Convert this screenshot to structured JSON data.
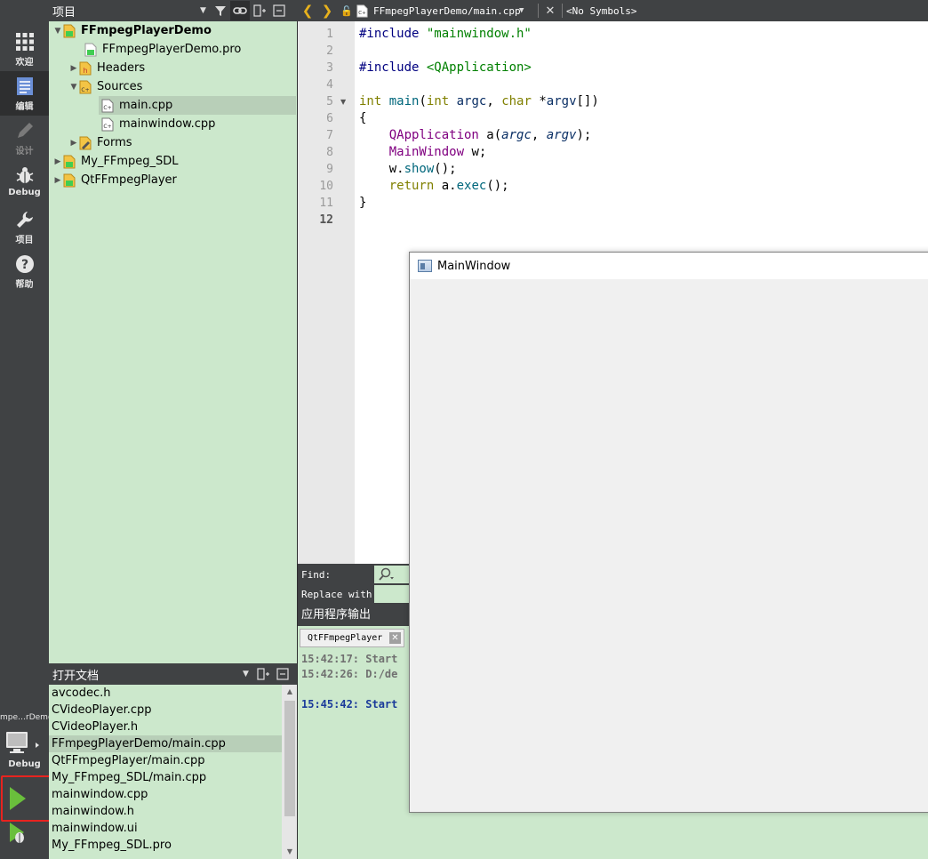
{
  "mode_bar": {
    "modes": [
      {
        "label": "欢迎",
        "icon": "grid-icon"
      },
      {
        "label": "编辑",
        "icon": "document-edit-icon"
      },
      {
        "label": "设计",
        "icon": "pencil-icon"
      },
      {
        "label": "Debug",
        "icon": "bug-icon"
      },
      {
        "label": "项目",
        "icon": "wrench-icon"
      },
      {
        "label": "帮助",
        "icon": "help-icon"
      }
    ],
    "active_mode": "编辑",
    "kit_project": "mpe…rDemo",
    "kit_build": "Debug",
    "run_highlight_color": "#e8231f"
  },
  "project_panel": {
    "title": "项目",
    "tree": [
      {
        "label": "FFmpegPlayerDemo",
        "icon": "qt-project-icon",
        "expanded": true,
        "bold": true
      },
      {
        "label": "FFmpegPlayerDemo.pro",
        "icon": "pro-file-icon"
      },
      {
        "label": "Headers",
        "icon": "header-folder-icon",
        "expanded": false
      },
      {
        "label": "Sources",
        "icon": "source-folder-icon",
        "expanded": true
      },
      {
        "label": "main.cpp",
        "icon": "cpp-file-icon",
        "selected": true
      },
      {
        "label": "mainwindow.cpp",
        "icon": "cpp-file-icon"
      },
      {
        "label": "Forms",
        "icon": "forms-folder-icon",
        "expanded": false
      },
      {
        "label": "My_FFmpeg_SDL",
        "icon": "qt-project-icon",
        "expanded": false
      },
      {
        "label": "QtFFmpegPlayer",
        "icon": "qt-project-icon",
        "expanded": false
      }
    ]
  },
  "open_documents": {
    "title": "打开文档",
    "items": [
      "avcodec.h",
      "CVideoPlayer.cpp",
      "CVideoPlayer.h",
      "FFmpegPlayerDemo/main.cpp",
      "QtFFmpegPlayer/main.cpp",
      "My_FFmpeg_SDL/main.cpp",
      "mainwindow.cpp",
      "mainwindow.h",
      "mainwindow.ui",
      "My_FFmpeg_SDL.pro"
    ],
    "selected": "FFmpegPlayerDemo/main.cpp"
  },
  "editor_toolbar": {
    "current_file": "FFmpegPlayerDemo/main.cpp",
    "symbols": "<No Symbols>"
  },
  "editor": {
    "line_numbers": [
      "1",
      "2",
      "3",
      "4",
      "5",
      "6",
      "7",
      "8",
      "9",
      "10",
      "11",
      "12"
    ],
    "current_line": "12",
    "code": {
      "l1_pp": "#include ",
      "l1_str": "\"mainwindow.h\"",
      "l3_pp": "#include ",
      "l3_str": "<QApplication>",
      "l5_kw1": "int",
      "l5_fn": "main",
      "l5_p1": "(",
      "l5_kw2": "int",
      "l5_par1": "argc",
      "l5_p2": ", ",
      "l5_kw3": "char",
      "l5_p3": " *",
      "l5_par2": "argv",
      "l5_p4": "[])",
      "l6": "{",
      "l7_cls": "QApplication",
      "l7_a": " a(",
      "l7_par1": "argc",
      "l7_c": ", ",
      "l7_par2": "argv",
      "l7_e": ");",
      "l8_cls": "MainWindow",
      "l8_rest": " w;",
      "l9_w": "w.",
      "l9_fn": "show",
      "l9_e": "();",
      "l10_kw": "return",
      "l10_a": " a.",
      "l10_fn": "exec",
      "l10_e": "();",
      "l11": "}"
    }
  },
  "find_bar": {
    "find_label": "Find:",
    "replace_label": "Replace with:"
  },
  "output_pane": {
    "title": "应用程序输出",
    "tab_label": "QtFFmpegPlayer",
    "lines": [
      {
        "text": "15:42:17: Start",
        "color": "gray"
      },
      {
        "text": "15:42:26: D:/de",
        "color": "gray"
      },
      {
        "text": "15:45:42: Start",
        "color": "blue"
      }
    ]
  },
  "app_window": {
    "title": "MainWindow"
  }
}
